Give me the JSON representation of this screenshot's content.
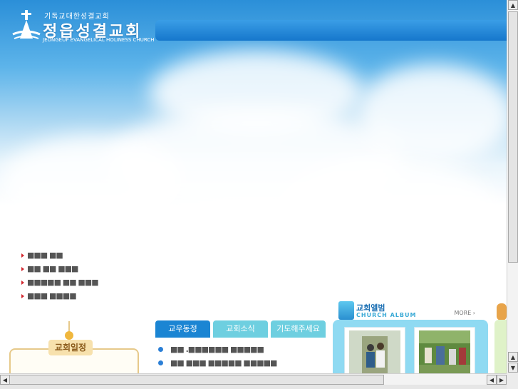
{
  "logo": {
    "subtitle": "기독교대한성결교회",
    "title": "정읍성결교회",
    "english": "JEONGEUP EVANGELICAL HOLINESS CHURCH"
  },
  "side_links": [
    {
      "label": "■■■ ■■"
    },
    {
      "label": "■■ ■■ ■■■"
    },
    {
      "label": "■■■■■ ■■ ■■■"
    },
    {
      "label": "■■■ ■■■■"
    }
  ],
  "calendar": {
    "label": "교회일정"
  },
  "tabs": [
    {
      "label": "교우동정",
      "active": true
    },
    {
      "label": "교회소식",
      "active": false
    },
    {
      "label": "기도해주세요",
      "active": false
    }
  ],
  "news": [
    {
      "text": "■■ .■■■■■■ ■■■■■"
    },
    {
      "text": "■■ ■■■ ■■■■■ ■■■■■"
    },
    {
      "text": "■■ ■■■■■■ ■■■■■"
    }
  ],
  "album": {
    "title": "교회앨범",
    "subtitle": "CHURCH ALBUM",
    "more": "MORE"
  },
  "colors": {
    "sky_top": "#2b8fd8",
    "nav_bar": "#1677cc",
    "tab_active": "#1b85d3",
    "tab_inactive": "#6ecfe0",
    "link_arrow": "#d2272e",
    "album_panel": "#8fdaf2"
  },
  "icons": {
    "logo": "church-logo-icon",
    "scroll_up": "arrow-up-icon",
    "scroll_down": "arrow-down-icon",
    "scroll_left": "arrow-left-icon",
    "scroll_right": "arrow-right-icon"
  }
}
